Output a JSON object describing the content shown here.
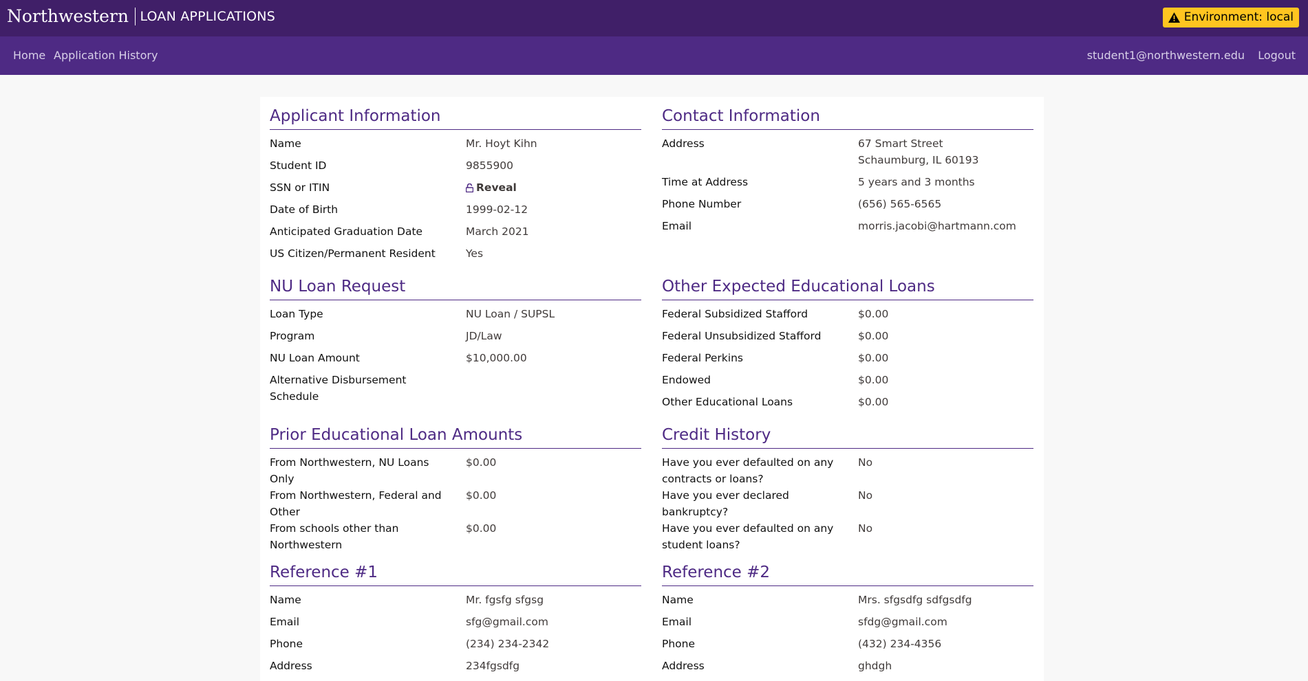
{
  "header": {
    "brand_name": "Northwestern",
    "brand_sub": "LOAN APPLICATIONS",
    "env_label": "Environment: local"
  },
  "nav": {
    "home": "Home",
    "history": "Application History",
    "user_email": "student1@northwestern.edu",
    "logout": "Logout"
  },
  "applicant": {
    "title": "Applicant Information",
    "rows": [
      {
        "label": "Name",
        "value": "Mr. Hoyt Kihn"
      },
      {
        "label": "Student ID",
        "value": "9855900"
      },
      {
        "label": "SSN or ITIN",
        "value": "Reveal"
      },
      {
        "label": "Date of Birth",
        "value": "1999-02-12"
      },
      {
        "label": "Anticipated Graduation Date",
        "value": "March 2021"
      },
      {
        "label": "US Citizen/Permanent Resident",
        "value": "Yes"
      }
    ]
  },
  "contact": {
    "title": "Contact Information",
    "rows": [
      {
        "label": "Address",
        "value": "67 Smart Street",
        "value2": "Schaumburg, IL 60193"
      },
      {
        "label": "Time at Address",
        "value": "5 years and 3 months"
      },
      {
        "label": "Phone Number",
        "value": "(656) 565-6565"
      },
      {
        "label": "Email",
        "value": "morris.jacobi@hartmann.com"
      }
    ]
  },
  "loan_request": {
    "title": "NU Loan Request",
    "rows": [
      {
        "label": "Loan Type",
        "value": "NU Loan / SUPSL"
      },
      {
        "label": "Program",
        "value": "JD/Law"
      },
      {
        "label": "NU Loan Amount",
        "value": "$10,000.00"
      },
      {
        "label": "Alternative Disbursement Schedule",
        "value": ""
      }
    ]
  },
  "other_loans": {
    "title": "Other Expected Educational Loans",
    "rows": [
      {
        "label": "Federal Subsidized Stafford",
        "value": "$0.00"
      },
      {
        "label": "Federal Unsubsidized Stafford",
        "value": "$0.00"
      },
      {
        "label": "Federal Perkins",
        "value": "$0.00"
      },
      {
        "label": "Endowed",
        "value": "$0.00"
      },
      {
        "label": "Other Educational Loans",
        "value": "$0.00"
      }
    ]
  },
  "prior_loans": {
    "title": "Prior Educational Loan Amounts",
    "rows": [
      {
        "label": "From Northwestern, NU Loans Only",
        "value": "$0.00"
      },
      {
        "label": "From Northwestern, Federal and Other",
        "value": "$0.00"
      },
      {
        "label": "From schools other than Northwestern",
        "value": "$0.00"
      }
    ]
  },
  "credit": {
    "title": "Credit History",
    "rows": [
      {
        "label": "Have you ever defaulted on any contracts or loans?",
        "value": "No"
      },
      {
        "label": "Have you ever declared bankruptcy?",
        "value": "No"
      },
      {
        "label": "Have you ever defaulted on any student loans?",
        "value": "No"
      }
    ]
  },
  "reference1": {
    "title": "Reference #1",
    "rows": [
      {
        "label": "Name",
        "value": "Mr. fgsfg sfgsg"
      },
      {
        "label": "Email",
        "value": "sfg@gmail.com"
      },
      {
        "label": "Phone",
        "value": "(234) 234-2342"
      },
      {
        "label": "Address",
        "value": "234fgsdfg"
      }
    ]
  },
  "reference2": {
    "title": "Reference #2",
    "rows": [
      {
        "label": "Name",
        "value": "Mrs. sfgsdfg sdfgsdfg"
      },
      {
        "label": "Email",
        "value": "sfdg@gmail.com"
      },
      {
        "label": "Phone",
        "value": "(432) 234-4356"
      },
      {
        "label": "Address",
        "value": "ghdgh"
      }
    ]
  },
  "colors": {
    "topbar": "#401f68",
    "navbar": "#4e2a84",
    "accent": "#4e2a84",
    "badge": "#ffc520"
  },
  "icons": {
    "warning": "warning-icon",
    "unlock": "unlock-icon"
  }
}
